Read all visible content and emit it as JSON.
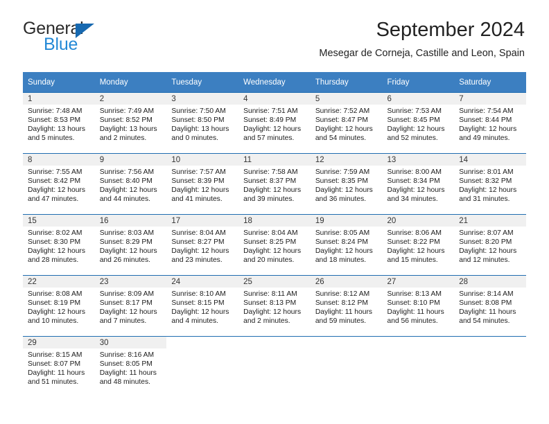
{
  "brand": {
    "word_one": "General",
    "word_two": "Blue",
    "triangle_icon": "triangle-icon",
    "accent_color": "#1769b0",
    "blue_text_color": "#2489d6"
  },
  "header": {
    "title": "September 2024",
    "subtitle": "Mesegar de Corneja, Castille and Leon, Spain"
  },
  "theme": {
    "header_bg": "#3c7fc1",
    "daynum_bg": "#f0f0f0",
    "row_divider": "#1e6cb0"
  },
  "calendar": {
    "weekday_headers": [
      "Sunday",
      "Monday",
      "Tuesday",
      "Wednesday",
      "Thursday",
      "Friday",
      "Saturday"
    ],
    "weeks": [
      [
        {
          "day": "1",
          "sunrise": "Sunrise: 7:48 AM",
          "sunset": "Sunset: 8:53 PM",
          "daylight_line1": "Daylight: 13 hours",
          "daylight_line2": "and 5 minutes."
        },
        {
          "day": "2",
          "sunrise": "Sunrise: 7:49 AM",
          "sunset": "Sunset: 8:52 PM",
          "daylight_line1": "Daylight: 13 hours",
          "daylight_line2": "and 2 minutes."
        },
        {
          "day": "3",
          "sunrise": "Sunrise: 7:50 AM",
          "sunset": "Sunset: 8:50 PM",
          "daylight_line1": "Daylight: 13 hours",
          "daylight_line2": "and 0 minutes."
        },
        {
          "day": "4",
          "sunrise": "Sunrise: 7:51 AM",
          "sunset": "Sunset: 8:49 PM",
          "daylight_line1": "Daylight: 12 hours",
          "daylight_line2": "and 57 minutes."
        },
        {
          "day": "5",
          "sunrise": "Sunrise: 7:52 AM",
          "sunset": "Sunset: 8:47 PM",
          "daylight_line1": "Daylight: 12 hours",
          "daylight_line2": "and 54 minutes."
        },
        {
          "day": "6",
          "sunrise": "Sunrise: 7:53 AM",
          "sunset": "Sunset: 8:45 PM",
          "daylight_line1": "Daylight: 12 hours",
          "daylight_line2": "and 52 minutes."
        },
        {
          "day": "7",
          "sunrise": "Sunrise: 7:54 AM",
          "sunset": "Sunset: 8:44 PM",
          "daylight_line1": "Daylight: 12 hours",
          "daylight_line2": "and 49 minutes."
        }
      ],
      [
        {
          "day": "8",
          "sunrise": "Sunrise: 7:55 AM",
          "sunset": "Sunset: 8:42 PM",
          "daylight_line1": "Daylight: 12 hours",
          "daylight_line2": "and 47 minutes."
        },
        {
          "day": "9",
          "sunrise": "Sunrise: 7:56 AM",
          "sunset": "Sunset: 8:40 PM",
          "daylight_line1": "Daylight: 12 hours",
          "daylight_line2": "and 44 minutes."
        },
        {
          "day": "10",
          "sunrise": "Sunrise: 7:57 AM",
          "sunset": "Sunset: 8:39 PM",
          "daylight_line1": "Daylight: 12 hours",
          "daylight_line2": "and 41 minutes."
        },
        {
          "day": "11",
          "sunrise": "Sunrise: 7:58 AM",
          "sunset": "Sunset: 8:37 PM",
          "daylight_line1": "Daylight: 12 hours",
          "daylight_line2": "and 39 minutes."
        },
        {
          "day": "12",
          "sunrise": "Sunrise: 7:59 AM",
          "sunset": "Sunset: 8:35 PM",
          "daylight_line1": "Daylight: 12 hours",
          "daylight_line2": "and 36 minutes."
        },
        {
          "day": "13",
          "sunrise": "Sunrise: 8:00 AM",
          "sunset": "Sunset: 8:34 PM",
          "daylight_line1": "Daylight: 12 hours",
          "daylight_line2": "and 34 minutes."
        },
        {
          "day": "14",
          "sunrise": "Sunrise: 8:01 AM",
          "sunset": "Sunset: 8:32 PM",
          "daylight_line1": "Daylight: 12 hours",
          "daylight_line2": "and 31 minutes."
        }
      ],
      [
        {
          "day": "15",
          "sunrise": "Sunrise: 8:02 AM",
          "sunset": "Sunset: 8:30 PM",
          "daylight_line1": "Daylight: 12 hours",
          "daylight_line2": "and 28 minutes."
        },
        {
          "day": "16",
          "sunrise": "Sunrise: 8:03 AM",
          "sunset": "Sunset: 8:29 PM",
          "daylight_line1": "Daylight: 12 hours",
          "daylight_line2": "and 26 minutes."
        },
        {
          "day": "17",
          "sunrise": "Sunrise: 8:04 AM",
          "sunset": "Sunset: 8:27 PM",
          "daylight_line1": "Daylight: 12 hours",
          "daylight_line2": "and 23 minutes."
        },
        {
          "day": "18",
          "sunrise": "Sunrise: 8:04 AM",
          "sunset": "Sunset: 8:25 PM",
          "daylight_line1": "Daylight: 12 hours",
          "daylight_line2": "and 20 minutes."
        },
        {
          "day": "19",
          "sunrise": "Sunrise: 8:05 AM",
          "sunset": "Sunset: 8:24 PM",
          "daylight_line1": "Daylight: 12 hours",
          "daylight_line2": "and 18 minutes."
        },
        {
          "day": "20",
          "sunrise": "Sunrise: 8:06 AM",
          "sunset": "Sunset: 8:22 PM",
          "daylight_line1": "Daylight: 12 hours",
          "daylight_line2": "and 15 minutes."
        },
        {
          "day": "21",
          "sunrise": "Sunrise: 8:07 AM",
          "sunset": "Sunset: 8:20 PM",
          "daylight_line1": "Daylight: 12 hours",
          "daylight_line2": "and 12 minutes."
        }
      ],
      [
        {
          "day": "22",
          "sunrise": "Sunrise: 8:08 AM",
          "sunset": "Sunset: 8:19 PM",
          "daylight_line1": "Daylight: 12 hours",
          "daylight_line2": "and 10 minutes."
        },
        {
          "day": "23",
          "sunrise": "Sunrise: 8:09 AM",
          "sunset": "Sunset: 8:17 PM",
          "daylight_line1": "Daylight: 12 hours",
          "daylight_line2": "and 7 minutes."
        },
        {
          "day": "24",
          "sunrise": "Sunrise: 8:10 AM",
          "sunset": "Sunset: 8:15 PM",
          "daylight_line1": "Daylight: 12 hours",
          "daylight_line2": "and 4 minutes."
        },
        {
          "day": "25",
          "sunrise": "Sunrise: 8:11 AM",
          "sunset": "Sunset: 8:13 PM",
          "daylight_line1": "Daylight: 12 hours",
          "daylight_line2": "and 2 minutes."
        },
        {
          "day": "26",
          "sunrise": "Sunrise: 8:12 AM",
          "sunset": "Sunset: 8:12 PM",
          "daylight_line1": "Daylight: 11 hours",
          "daylight_line2": "and 59 minutes."
        },
        {
          "day": "27",
          "sunrise": "Sunrise: 8:13 AM",
          "sunset": "Sunset: 8:10 PM",
          "daylight_line1": "Daylight: 11 hours",
          "daylight_line2": "and 56 minutes."
        },
        {
          "day": "28",
          "sunrise": "Sunrise: 8:14 AM",
          "sunset": "Sunset: 8:08 PM",
          "daylight_line1": "Daylight: 11 hours",
          "daylight_line2": "and 54 minutes."
        }
      ],
      [
        {
          "day": "29",
          "sunrise": "Sunrise: 8:15 AM",
          "sunset": "Sunset: 8:07 PM",
          "daylight_line1": "Daylight: 11 hours",
          "daylight_line2": "and 51 minutes."
        },
        {
          "day": "30",
          "sunrise": "Sunrise: 8:16 AM",
          "sunset": "Sunset: 8:05 PM",
          "daylight_line1": "Daylight: 11 hours",
          "daylight_line2": "and 48 minutes."
        },
        {
          "day": "",
          "sunrise": "",
          "sunset": "",
          "daylight_line1": "",
          "daylight_line2": ""
        },
        {
          "day": "",
          "sunrise": "",
          "sunset": "",
          "daylight_line1": "",
          "daylight_line2": ""
        },
        {
          "day": "",
          "sunrise": "",
          "sunset": "",
          "daylight_line1": "",
          "daylight_line2": ""
        },
        {
          "day": "",
          "sunrise": "",
          "sunset": "",
          "daylight_line1": "",
          "daylight_line2": ""
        },
        {
          "day": "",
          "sunrise": "",
          "sunset": "",
          "daylight_line1": "",
          "daylight_line2": ""
        }
      ]
    ]
  }
}
